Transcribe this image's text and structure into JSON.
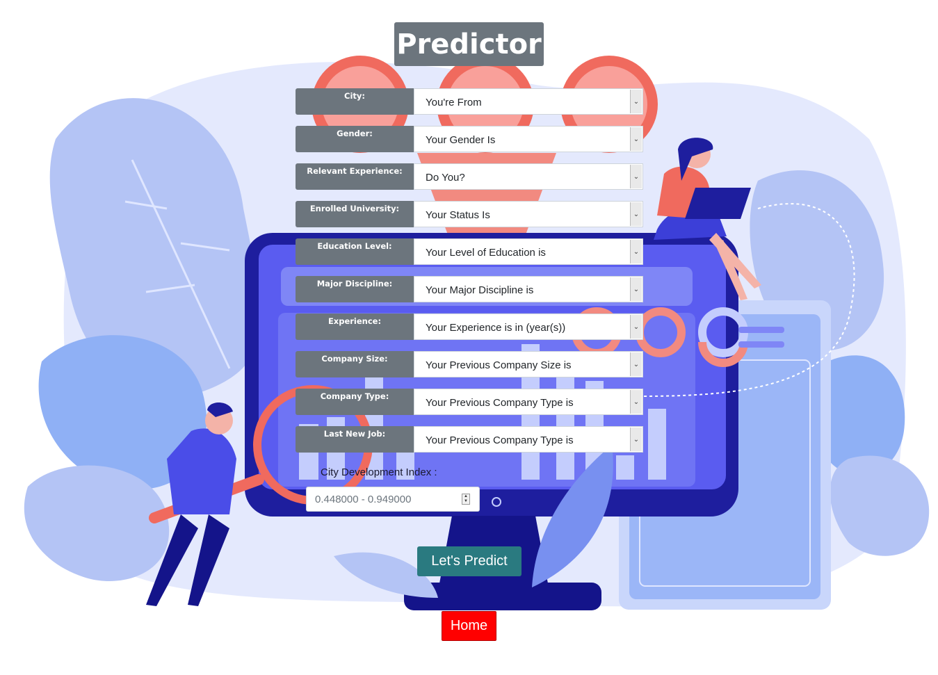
{
  "header": {
    "title": "Predictor"
  },
  "form": {
    "fields": [
      {
        "label": "City:",
        "value": "You're From"
      },
      {
        "label": "Gender:",
        "value": "Your Gender Is"
      },
      {
        "label": "Relevant Experience:",
        "value": "Do You?"
      },
      {
        "label": "Enrolled University:",
        "value": "Your Status Is"
      },
      {
        "label": "Education Level:",
        "value": "Your Level of Education is"
      },
      {
        "label": "Major Discipline:",
        "value": "Your Major Discipline is"
      },
      {
        "label": "Experience:",
        "value": "Your Experience is in (year(s))"
      },
      {
        "label": "Company Size:",
        "value": "Your Previous Company Size is"
      },
      {
        "label": "Company Type:",
        "value": "Your Previous Company Type is"
      },
      {
        "label": "Last New Job:",
        "value": "Your Previous Company Type is"
      }
    ],
    "cdi": {
      "label": "City Development Index :",
      "placeholder": "0.448000 - 0.949000"
    },
    "predict_label": "Let's Predict",
    "home_label": "Home"
  },
  "icons": [
    "chevron-down-icon",
    "spinner-icon"
  ],
  "colors": {
    "label_bg": "#6c757d",
    "predict_bg": "#2a7a80",
    "home_bg": "#ff0000",
    "illustration_blue": "#6a6bf0",
    "illustration_coral": "#f06a5e"
  }
}
